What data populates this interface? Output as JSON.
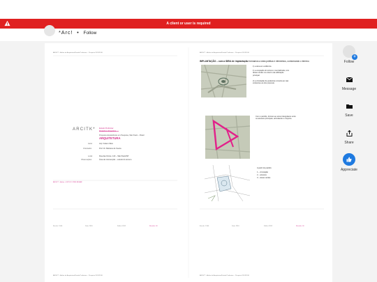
{
  "alert": {
    "message": "A client or user is required"
  },
  "header": {
    "title": "*Arc!",
    "separator": "•",
    "follow": "Follow"
  },
  "sidebar": {
    "follow": "Follow",
    "message": "Message",
    "save": "Save",
    "share": "Share",
    "appreciate": "Appreciate"
  },
  "colors": {
    "alert": "#e02020",
    "accent": "#1f7ae0",
    "pink": "#d32b89"
  },
  "left_page": {
    "header_note": "ARCH*T • Atelier de Arquitetura/Estudo Preliminar – Pesquisa 2014/2016",
    "logo": "ARCITK*",
    "course": "Estudo Preliminar",
    "course_sub": "Disciplina obrigatória",
    "subtitle": "Proposta Arquitetônica em Pesquisa, São Paulo – Brasil",
    "project": "ARQUITETURA",
    "rows": [
      {
        "label": "Autor",
        "value": "Arq. Fulano Silva"
      },
      {
        "label": "Orientador",
        "value": "Prof. Dr. Beltrano de Souza"
      },
      {
        "label": "Local",
        "value": "Rua das Flores, 123 – São Paulo/SP"
      },
      {
        "label": "Observações",
        "value": "Área de intervenção – estudo do terreno"
      }
    ],
    "footer_left": "ARCH*T • Atelier • ESTUDO PRELIMINAR",
    "footer_cols": [
      "Escala: 1:500",
      "Data: 2016",
      "Folha: 01/02",
      "Revisão: 00"
    ]
  },
  "right_page": {
    "header_note": "ARCH*T • Atelier de Arquitetura/Estudo Preliminar – Pesquisa 2014/2016",
    "heading": "IMPLANTAÇÃO – com a IDEIA de implantação",
    "heading_rest": "formamos a área pública e elementos, contornando o terreno",
    "note1_title": "1) a área em evidência",
    "note1_body": "1) a ocupação do terreno é centralizada, com faixas verdes no entorno da edificação principal.",
    "note2_body": "2) a circulação de pedestres conecta as vias existentes ao lote proposto.",
    "note3_body": "Com o partido, formam-se eixos triangulares entre os acessos principais, articulando o conjunto.",
    "list_title": "A partir do partido:",
    "list": [
      "1 – circulação",
      "2 – acessos",
      "3 – áreas verdes"
    ],
    "footer_cols": [
      "Escala: 1:500",
      "Data: 2016",
      "Folha: 02/02",
      "Revisão: 00"
    ]
  }
}
